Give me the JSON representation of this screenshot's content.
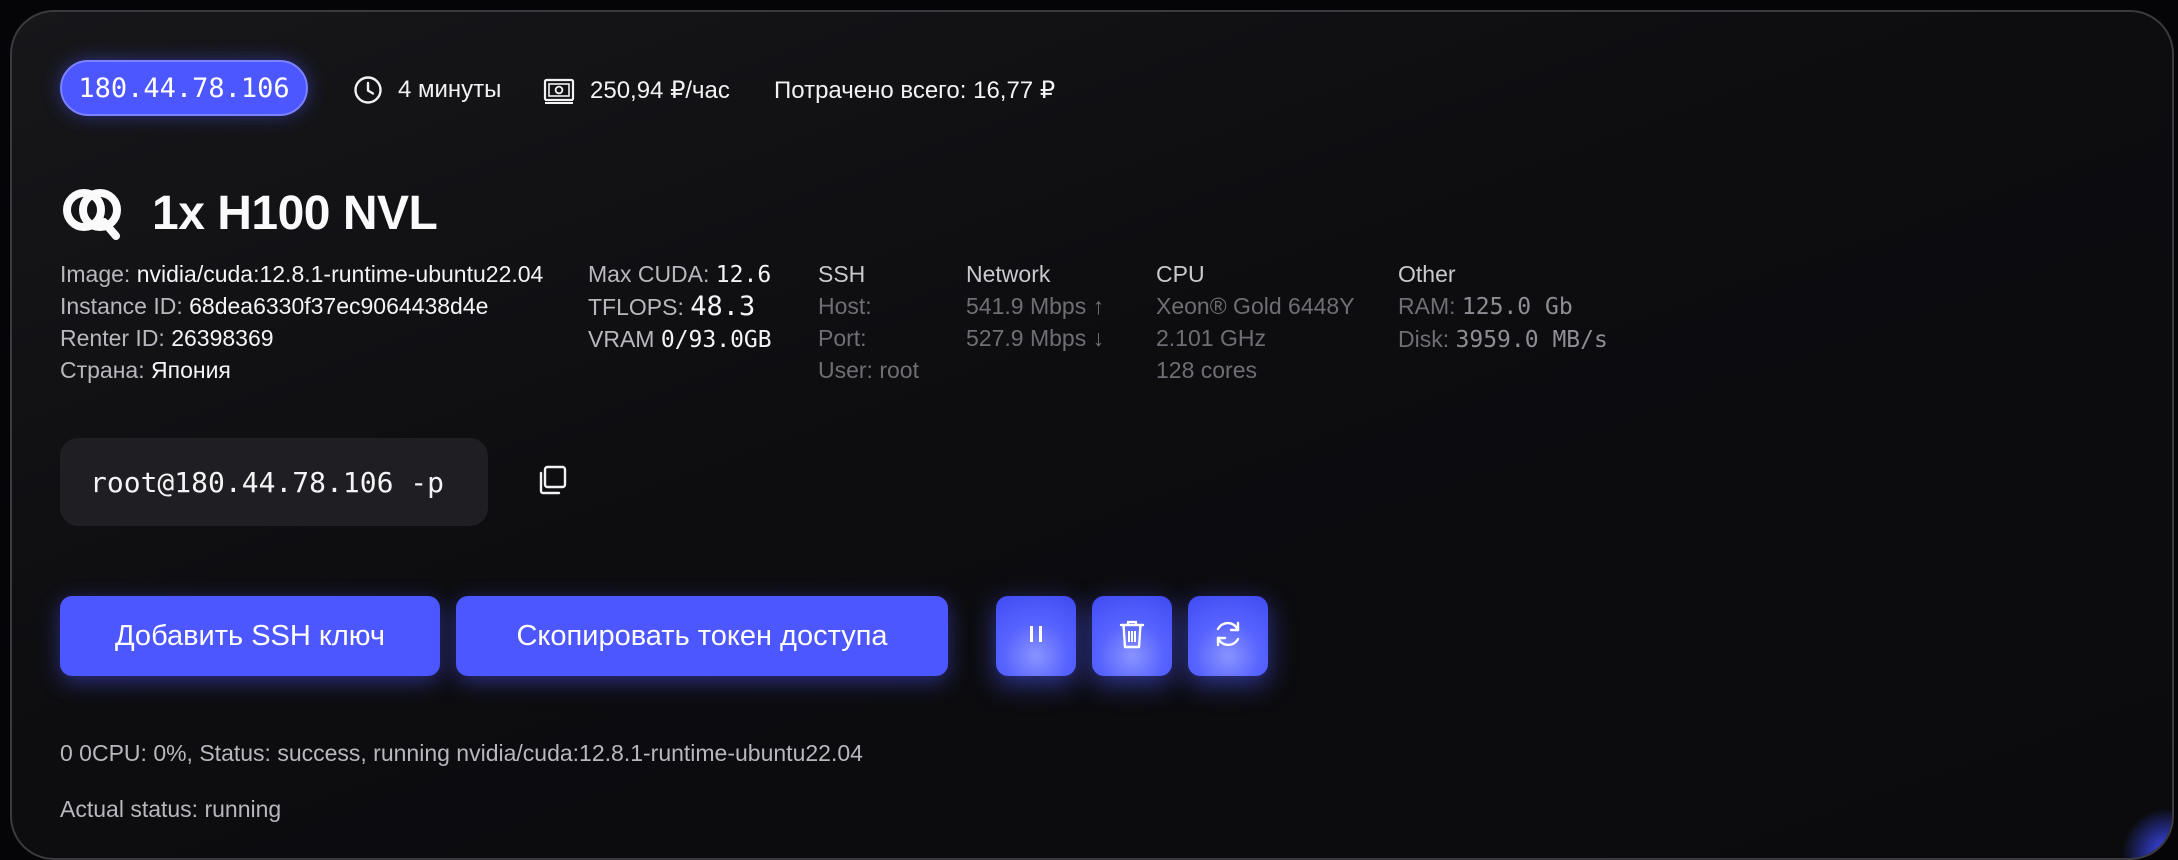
{
  "header": {
    "ip": "180.44.78.106",
    "uptime": "4 минуты",
    "price": "250,94 ₽/час",
    "spent": "Потрачено всего: 16,77 ₽"
  },
  "instance": {
    "title": "1x H100 NVL",
    "image_label": "Image:",
    "image_value": "nvidia/cuda:12.8.1-runtime-ubuntu22.04",
    "instance_id_label": "Instance ID:",
    "instance_id_value": "68dea6330f37ec9064438d4e",
    "renter_id_label": "Renter ID:",
    "renter_id_value": "26398369",
    "country_label": "Страна:",
    "country_value": "Япония"
  },
  "gpu": {
    "max_cuda_label": "Max CUDA:",
    "max_cuda_value": "12.6",
    "tflops_label": "TFLOPS:",
    "tflops_value": "48.3",
    "vram_label": "VRAM",
    "vram_value": "0/93.0GB"
  },
  "ssh": {
    "heading": "SSH",
    "host": "Host:",
    "port": "Port:",
    "user": "User: root"
  },
  "network": {
    "heading": "Network",
    "up": "541.9 Mbps ↑",
    "down": "527.9 Mbps ↓"
  },
  "cpu": {
    "heading": "CPU",
    "model": "Xeon® Gold 6448Y",
    "freq": "2.101 GHz",
    "cores": "128 cores"
  },
  "other": {
    "heading": "Other",
    "ram_label": "RAM:",
    "ram_value": "125.0 Gb",
    "disk_label": "Disk:",
    "disk_value": "3959.0 MB/s"
  },
  "command": {
    "text": "root@180.44.78.106 -p"
  },
  "actions": {
    "add_ssh_key": "Добавить SSH ключ",
    "copy_token": "Скопировать токен доступа"
  },
  "status": {
    "line1": "0 0CPU: 0%, Status: success, running nvidia/cuda:12.8.1-runtime-ubuntu22.04",
    "line2": "Actual status: running"
  },
  "colors": {
    "accent": "#4d57ff",
    "background": "#0d0d10"
  }
}
